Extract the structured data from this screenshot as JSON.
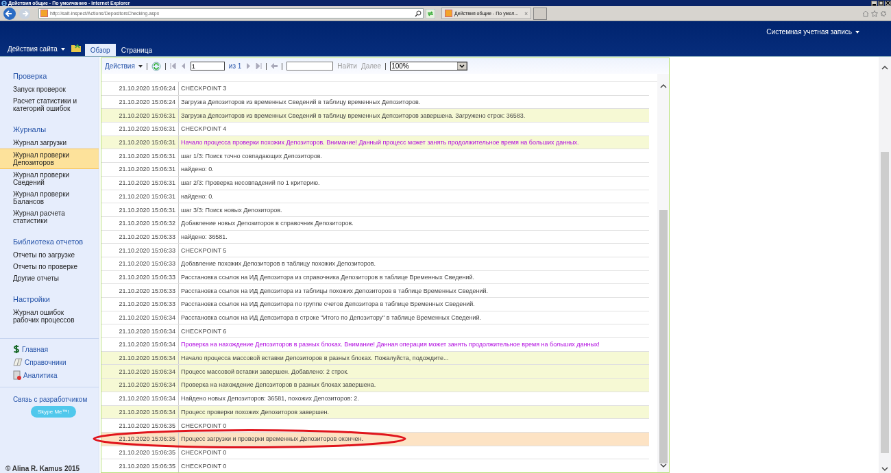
{
  "window": {
    "title": "Действия общие - По умолчанию - Internet Explorer"
  },
  "address_bar": {
    "url": "http://salt-inspect/Actions/DepositorsChecking.aspx"
  },
  "browser_tab": {
    "title": "Действия общие - По умол...",
    "close": "×"
  },
  "ribbon": {
    "site_actions": "Действия сайта",
    "tabs": [
      {
        "label": "Обзор",
        "selected": true
      },
      {
        "label": "Страница",
        "selected": false
      }
    ],
    "account": "Системная учетная запись"
  },
  "sidebar": {
    "sections": [
      {
        "title": "Проверка",
        "items": [
          {
            "label": "Запуск проверок",
            "selected": false
          },
          {
            "label": "Расчет статистики и категорий ошибок",
            "selected": false
          }
        ]
      },
      {
        "title": "Журналы",
        "items": [
          {
            "label": "Журнал загрузки",
            "selected": false
          },
          {
            "label": "Журнал проверки Депозиторов",
            "selected": true
          },
          {
            "label": "Журнал проверки Сведений",
            "selected": false
          },
          {
            "label": "Журнал проверки Балансов",
            "selected": false
          },
          {
            "label": "Журнал расчета статистики",
            "selected": false
          }
        ]
      },
      {
        "title": "Библиотека отчетов",
        "items": [
          {
            "label": "Отчеты по загрузке",
            "selected": false
          },
          {
            "label": "Отчеты по проверке",
            "selected": false
          },
          {
            "label": "Другие отчеты",
            "selected": false
          }
        ]
      },
      {
        "title": "Настройки",
        "items": [
          {
            "label": "Журнал ошибок рабочих процессов",
            "selected": false
          }
        ]
      }
    ],
    "links": [
      {
        "label": "Главная",
        "kind": "dollar"
      },
      {
        "label": "Справочники",
        "kind": "book"
      },
      {
        "label": "Аналитика",
        "kind": "report"
      }
    ],
    "contact": {
      "title": "Связь с разработчиком",
      "button": "Skype Me™!"
    },
    "footer": "© Alina R. Kamus 2015"
  },
  "report_toolbar": {
    "actions": "Действия",
    "page": "1",
    "of": "из 1",
    "find": "Найти",
    "next": "Далее",
    "zoom": "100%"
  },
  "table": {
    "rows": [
      {
        "time": "21.10.2020 15:06:24",
        "message": "CHECKPOINT 3",
        "kind": "plain",
        "emphasis": false
      },
      {
        "time": "21.10.2020 15:06:24",
        "message": "Загрузка Депозиторов из временных Сведений в таблицу временных Депозиторов.",
        "kind": "plain",
        "emphasis": false
      },
      {
        "time": "21.10.2020 15:06:31",
        "message": "Загрузка Депозиторов из временных Сведений в таблицу временных Депозиторов завершена. Загружено строк: 36583.",
        "kind": "note",
        "emphasis": false
      },
      {
        "time": "21.10.2020 15:06:31",
        "message": "CHECKPOINT 4",
        "kind": "plain",
        "emphasis": false
      },
      {
        "time": "21.10.2020 15:06:31",
        "message": "Начало процесса проверки похожих Депозиторов. Внимание! Данный процесс может занять продолжительное время на больших данных.",
        "kind": "note",
        "emphasis": true
      },
      {
        "time": "21.10.2020 15:06:31",
        "message": "шаг 1/3: Поиск точно совпадающих Депозиторов.",
        "kind": "plain",
        "emphasis": false
      },
      {
        "time": "21.10.2020 15:06:31",
        "message": "найдено: 0.",
        "kind": "plain",
        "emphasis": false
      },
      {
        "time": "21.10.2020 15:06:31",
        "message": "шаг 2/3: Проверка несовпадений по 1 критерию.",
        "kind": "plain",
        "emphasis": false
      },
      {
        "time": "21.10.2020 15:06:31",
        "message": "найдено: 0.",
        "kind": "plain",
        "emphasis": false
      },
      {
        "time": "21.10.2020 15:06:31",
        "message": "шаг 3/3: Поиск новых Депозиторов.",
        "kind": "plain",
        "emphasis": false
      },
      {
        "time": "21.10.2020 15:06:32",
        "message": "Добавление новых Депозиторов в справочник Депозиторов.",
        "kind": "plain",
        "emphasis": false
      },
      {
        "time": "21.10.2020 15:06:33",
        "message": "найдено: 36581.",
        "kind": "plain",
        "emphasis": false
      },
      {
        "time": "21.10.2020 15:06:33",
        "message": "CHECKPOINT 5",
        "kind": "plain",
        "emphasis": false
      },
      {
        "time": "21.10.2020 15:06:33",
        "message": "Добавление похожих Депозиторов в таблицу похожих Депозиторов.",
        "kind": "plain",
        "emphasis": false
      },
      {
        "time": "21.10.2020 15:06:33",
        "message": "Расстановка ссылок на ИД Депозитора из справочника Депозиторов в таблице Временных Сведений.",
        "kind": "plain",
        "emphasis": false
      },
      {
        "time": "21.10.2020 15:06:33",
        "message": "Расстановка ссылок на ИД Депозитора из таблицы похожих Депозиторов в таблице Временных Сведений.",
        "kind": "plain",
        "emphasis": false
      },
      {
        "time": "21.10.2020 15:06:33",
        "message": "Расстановка ссылок на ИД Депозитора по группе счетов Депозитора в таблице Временных Сведений.",
        "kind": "plain",
        "emphasis": false
      },
      {
        "time": "21.10.2020 15:06:34",
        "message": "Расстановка ссылок на ИД Депозитора в строке \"Итого по Депозитору\" в таблице Временных Сведений.",
        "kind": "plain",
        "emphasis": false
      },
      {
        "time": "21.10.2020 15:06:34",
        "message": "CHECKPOINT 6",
        "kind": "plain",
        "emphasis": false
      },
      {
        "time": "21.10.2020 15:06:34",
        "message": "Проверка на нахождение Депозиторов в разных блоках. Внимание! Данная операция может занять продолжительное время на больших данных!",
        "kind": "plain",
        "emphasis": true
      },
      {
        "time": "21.10.2020 15:06:34",
        "message": "Начало процесса массовой вставки Депозиторов в разных блоках. Пожалуйста, подождите...",
        "kind": "note",
        "emphasis": false
      },
      {
        "time": "21.10.2020 15:06:34",
        "message": "Процесс массовой вставки завершен. Добавлено: 2 строк.",
        "kind": "note",
        "emphasis": false
      },
      {
        "time": "21.10.2020 15:06:34",
        "message": "Проверка на нахождение Депозиторов в разных блоках завершена.",
        "kind": "note",
        "emphasis": false
      },
      {
        "time": "21.10.2020 15:06:34",
        "message": "Найдено новых Депозиторов: 36581, похожих Депозиторов: 2.",
        "kind": "plain",
        "emphasis": false
      },
      {
        "time": "21.10.2020 15:06:34",
        "message": "Процесс проверки похожих Депозиторов завершен.",
        "kind": "note",
        "emphasis": false
      },
      {
        "time": "21.10.2020 15:06:35",
        "message": "CHECKPOINT 0",
        "kind": "plain",
        "emphasis": false
      },
      {
        "time": "21.10.2020 15:06:35",
        "message": "Процесс загрузки и проверки временных Депозиторов окончен.",
        "kind": "final",
        "emphasis": false
      },
      {
        "time": "21.10.2020 15:06:35",
        "message": "CHECKPOINT 0",
        "kind": "plain",
        "emphasis": false
      },
      {
        "time": "21.10.2020 15:06:35",
        "message": "CHECKPOINT 0",
        "kind": "plain",
        "emphasis": false
      }
    ]
  }
}
